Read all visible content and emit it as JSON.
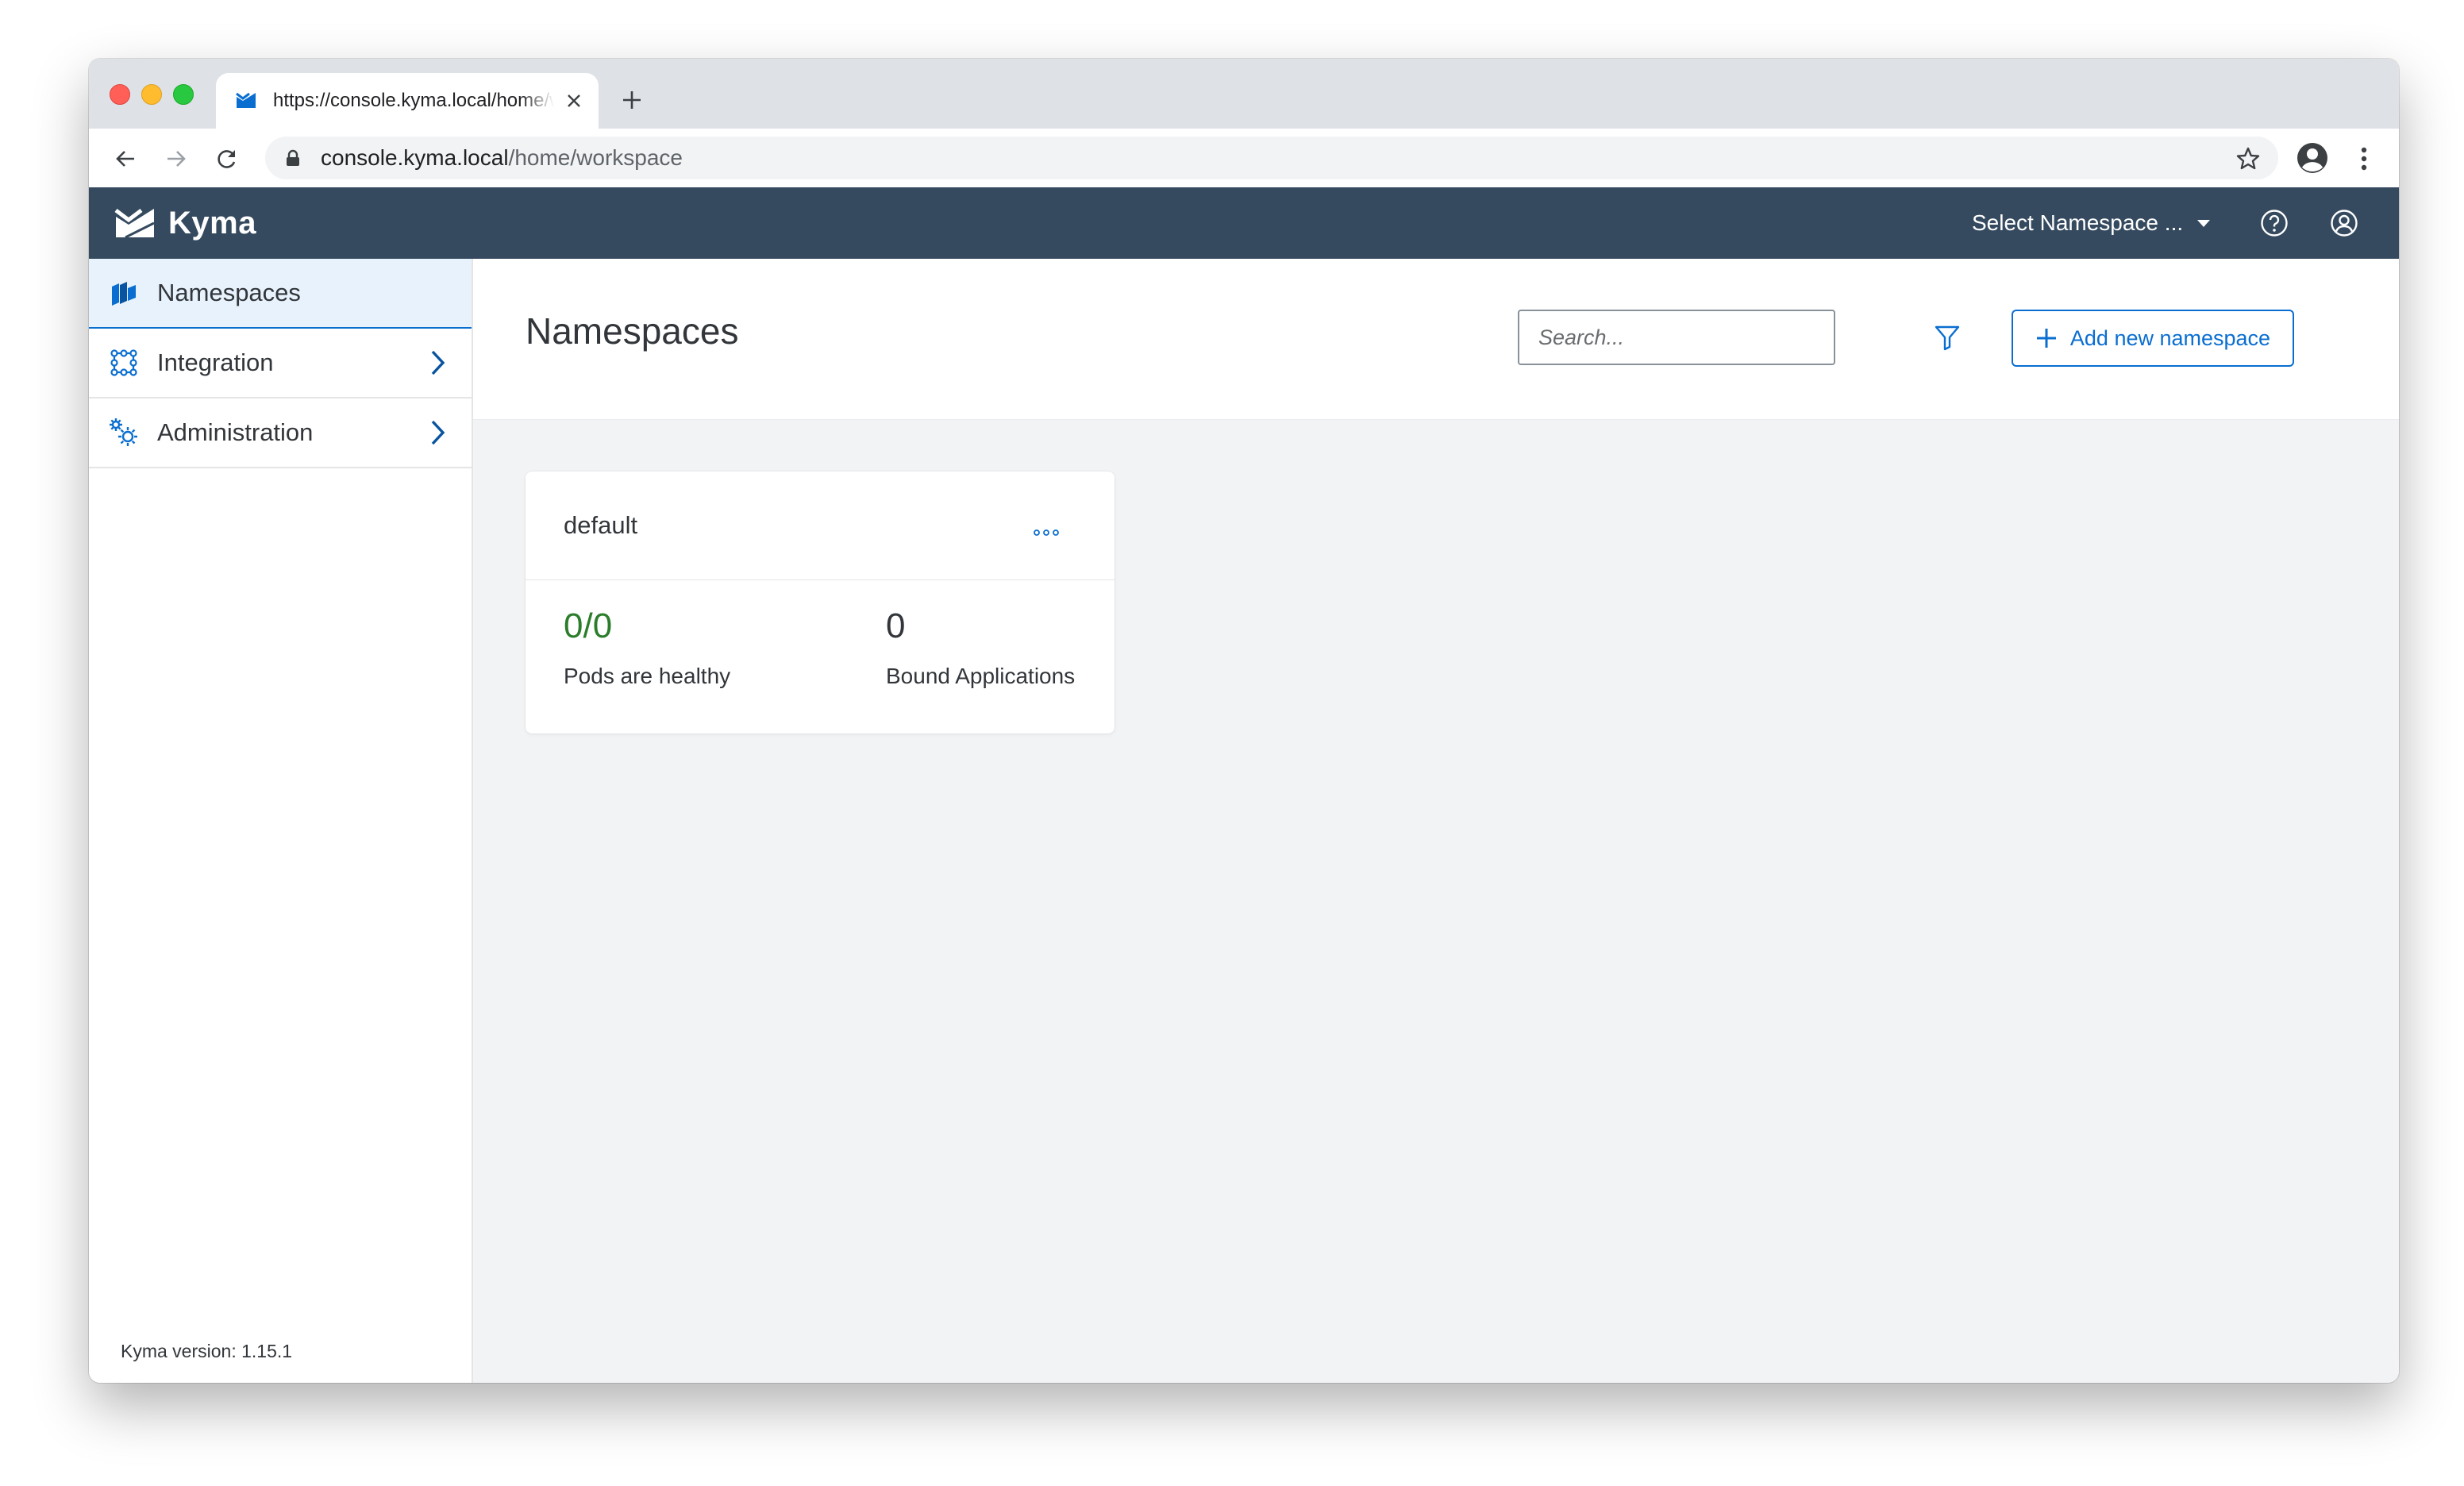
{
  "browser": {
    "tab_title": "https://console.kyma.local/home/workspace",
    "url_host": "console.kyma.local",
    "url_path": "/home/workspace"
  },
  "header": {
    "brand": "Kyma",
    "namespace_select": "Select Namespace ...",
    "background_color": "#354a5f"
  },
  "sidebar": {
    "items": [
      {
        "label": "Namespaces",
        "icon": "namespaces-icon",
        "active": true
      },
      {
        "label": "Integration",
        "icon": "integration-icon",
        "has_children": true
      },
      {
        "label": "Administration",
        "icon": "gears-icon",
        "has_children": true
      }
    ],
    "version": "Kyma version: 1.15.1"
  },
  "main": {
    "title": "Namespaces",
    "search_placeholder": "Search...",
    "add_button_label": "Add new namespace",
    "accent_color": "#0a6ed1"
  },
  "namespaces": [
    {
      "name": "default",
      "pods_value": "0/0",
      "pods_label": "Pods are healthy",
      "apps_value": "0",
      "apps_label": "Bound Applications"
    }
  ]
}
